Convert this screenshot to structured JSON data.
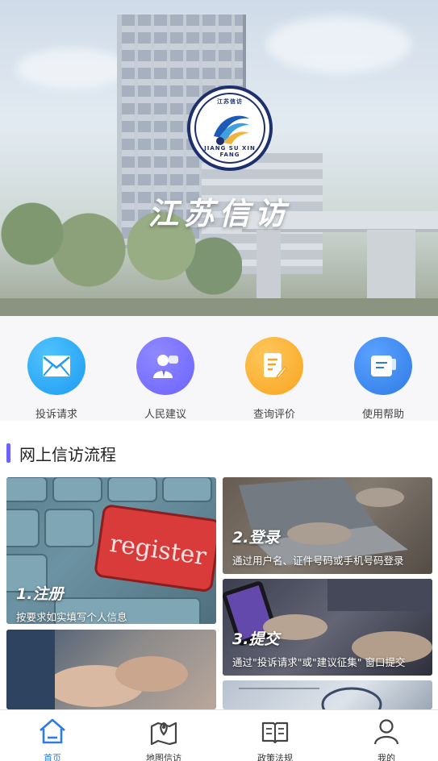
{
  "hero": {
    "title": "江苏信访",
    "emblem_top": "江苏信访",
    "emblem_bottom": "JIANG SU XIN FANG"
  },
  "actions": [
    {
      "label": "投诉请求",
      "icon": "envelope-icon",
      "color": "#1e9bf0"
    },
    {
      "label": "人民建议",
      "icon": "person-chat-icon",
      "color": "#6c63ff"
    },
    {
      "label": "查询评价",
      "icon": "document-edit-icon",
      "color": "#f7a520"
    },
    {
      "label": "使用帮助",
      "icon": "help-book-icon",
      "color": "#2f7be6"
    }
  ],
  "section": {
    "title": "网上信访流程",
    "accent": "#6c63ff"
  },
  "steps": [
    {
      "head": "1.注册",
      "sub": "按要求如实填写个人信息",
      "image": "register-keyboard-photo"
    },
    {
      "head": "2.登录",
      "sub": "通过用户名、证件号码或手机号码登录",
      "image": "laptop-typing-photo"
    },
    {
      "head": "3.提交",
      "sub": "通过\"投诉请求\"或\"建议征集\" 窗口提交",
      "image": "phone-hands-photo"
    },
    {
      "head": "",
      "sub": "",
      "image": "handshake-photo"
    },
    {
      "head": "",
      "sub": "",
      "image": "chart-desk-photo"
    }
  ],
  "tabbar": {
    "active_color": "#2f7be6",
    "items": [
      {
        "label": "首页",
        "icon": "home-icon",
        "active": true
      },
      {
        "label": "地图信访",
        "icon": "map-pin-icon",
        "active": false
      },
      {
        "label": "政策法规",
        "icon": "open-book-icon",
        "active": false
      },
      {
        "label": "我的",
        "icon": "user-icon",
        "active": false
      }
    ]
  }
}
